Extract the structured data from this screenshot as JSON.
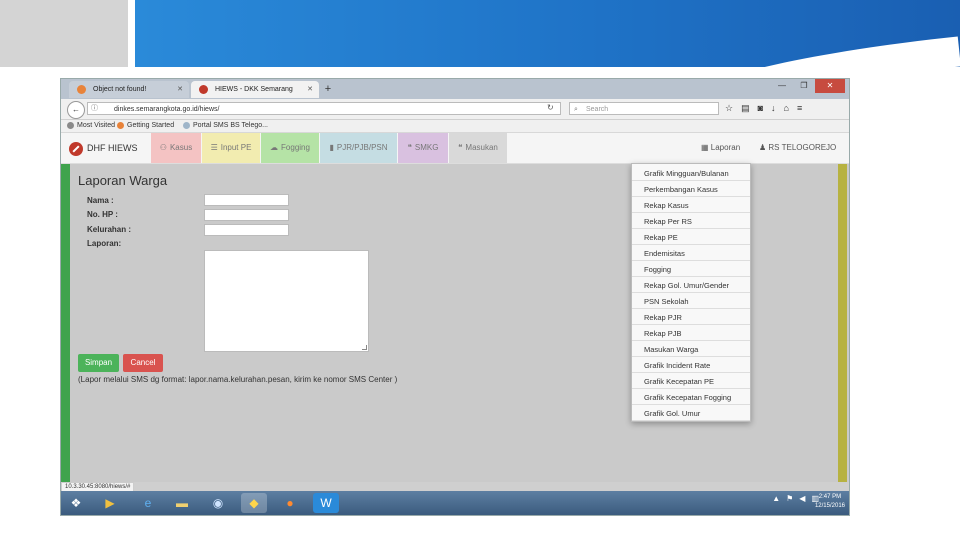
{
  "browser": {
    "tabs": [
      {
        "label": "Object not found!"
      },
      {
        "label": "HIEWS - DKK Semarang"
      }
    ],
    "url": "dinkes.semarangkota.go.id/hiews/",
    "search_placeholder": "Search",
    "bookmarks": [
      "Most Visited",
      "Getting Started",
      "Portal SMS BS Telego..."
    ]
  },
  "app": {
    "brand": "DHF HIEWS",
    "nav": [
      {
        "label": "Kasus",
        "icon": "users-icon",
        "color": "#f4c3c3"
      },
      {
        "label": "Input PE",
        "icon": "list-icon",
        "color": "#f2ecb0"
      },
      {
        "label": "Fogging",
        "icon": "cloud-icon",
        "color": "#b5e3a6"
      },
      {
        "label": "PJR/PJB/PSN",
        "icon": "file-icon",
        "color": "#c5dde3"
      },
      {
        "label": "SMKG",
        "icon": "comments-icon",
        "color": "#d9c1e0"
      },
      {
        "label": "Masukan",
        "icon": "comments-icon",
        "color": "#d9d9d9"
      }
    ],
    "laporan": "Laporan",
    "user": "RS TELOGOREJO"
  },
  "form": {
    "title": "Laporan Warga",
    "labels": {
      "nama": "Nama :",
      "hp": "No. HP :",
      "kelurahan": "Kelurahan :",
      "laporan": "Laporan:"
    },
    "save": "Simpan",
    "cancel": "Cancel",
    "note": "(Lapor melalui SMS dg format: lapor.nama.kelurahan.pesan, kirim ke nomor SMS Center )"
  },
  "dropdown": [
    "Grafik Mingguan/Bulanan",
    "Perkembangan Kasus",
    "Rekap Kasus",
    "Rekap Per RS",
    "Rekap PE",
    "Endemisitas",
    "Fogging",
    "Rekap Gol. Umur/Gender",
    "PSN Sekolah",
    "Rekap PJR",
    "Rekap PJB",
    "Masukan Warga",
    "Grafik Incident Rate",
    "Grafik Kecepatan PE",
    "Grafik Kecepatan Fogging",
    "Grafik Gol. Umur"
  ],
  "status_url": "10.3.30.45:8080/hiews/#",
  "clock": {
    "time": "2:47 PM",
    "date": "12/15/2016"
  },
  "colors": {
    "green_bar": "#3fa34d",
    "olive_bar": "#b7b241",
    "slide_blue": "#1f73c7"
  }
}
